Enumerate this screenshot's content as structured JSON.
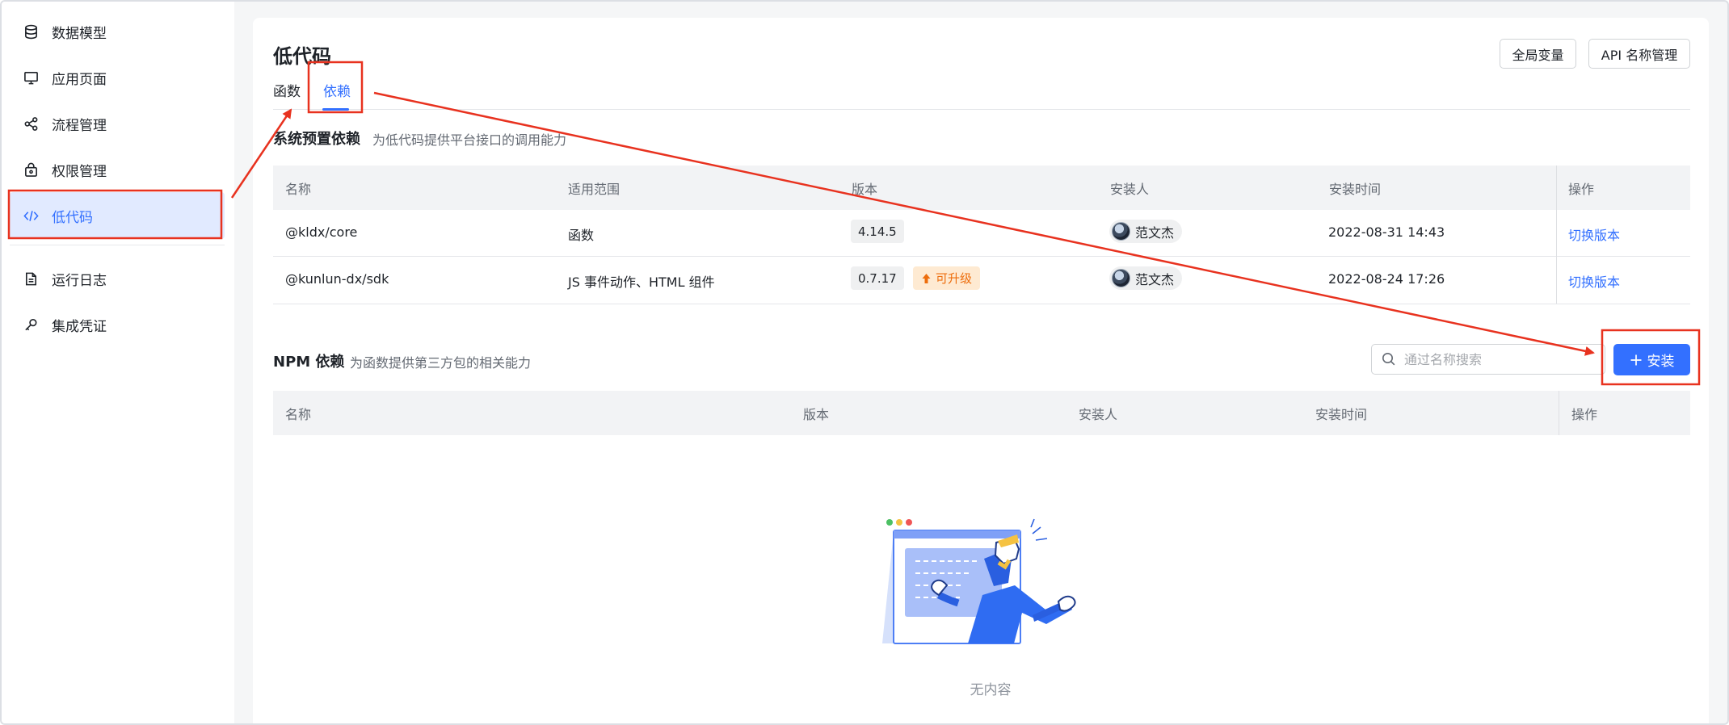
{
  "sidebar": {
    "items": [
      {
        "label": "数据模型",
        "icon": "database-icon"
      },
      {
        "label": "应用页面",
        "icon": "monitor-icon"
      },
      {
        "label": "流程管理",
        "icon": "flow-icon"
      },
      {
        "label": "权限管理",
        "icon": "lock-box-icon"
      },
      {
        "label": "低代码",
        "icon": "code-icon",
        "active": true
      },
      {
        "label": "运行日志",
        "icon": "document-icon"
      },
      {
        "label": "集成凭证",
        "icon": "key-icon"
      }
    ]
  },
  "page": {
    "title": "低代码",
    "global_vars_label": "全局变量",
    "api_names_label": "API 名称管理",
    "tabs": [
      {
        "label": "函数"
      },
      {
        "label": "依赖",
        "active": true
      }
    ]
  },
  "system_deps": {
    "title": "系统预置依赖",
    "desc": "为低代码提供平台接口的调用能力",
    "columns": [
      "名称",
      "适用范围",
      "版本",
      "安装人",
      "安装时间",
      "操作"
    ],
    "rows": [
      {
        "name": "@kldx/core",
        "scope": "函数",
        "version": "4.14.5",
        "upgrade": "",
        "installer": "范文杰",
        "time": "2022-08-31 14:43",
        "action": "切换版本"
      },
      {
        "name": "@kunlun-dx/sdk",
        "scope": "JS 事件动作、HTML 组件",
        "version": "0.7.17",
        "upgrade": "可升级",
        "installer": "范文杰",
        "time": "2022-08-24 17:26",
        "action": "切换版本"
      }
    ]
  },
  "npm_deps": {
    "title": "NPM 依赖",
    "desc": "为函数提供第三方包的相关能力",
    "search_placeholder": "通过名称搜索",
    "install_label": "安装",
    "columns": [
      "名称",
      "版本",
      "安装人",
      "安装时间",
      "操作"
    ],
    "empty_text": "无内容"
  },
  "colors": {
    "accent": "#3370ff",
    "annotation": "#e8321f",
    "upgrade": "#ed6d0c"
  }
}
